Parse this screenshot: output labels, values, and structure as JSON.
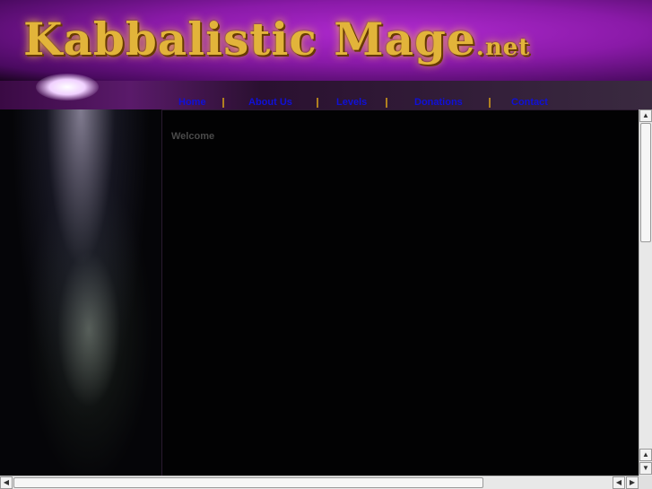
{
  "header": {
    "logo_main": "Kabbalistic Mage",
    "logo_suffix": ".net"
  },
  "nav": [
    {
      "label": "Home"
    },
    {
      "label": "About Us"
    },
    {
      "label": "Levels"
    },
    {
      "label": "Donations"
    },
    {
      "label": "Contact"
    }
  ],
  "content": {
    "heading": "Welcome"
  },
  "scrollbars": {
    "up": "▲",
    "down": "▼",
    "left": "◀",
    "right": "▶"
  }
}
